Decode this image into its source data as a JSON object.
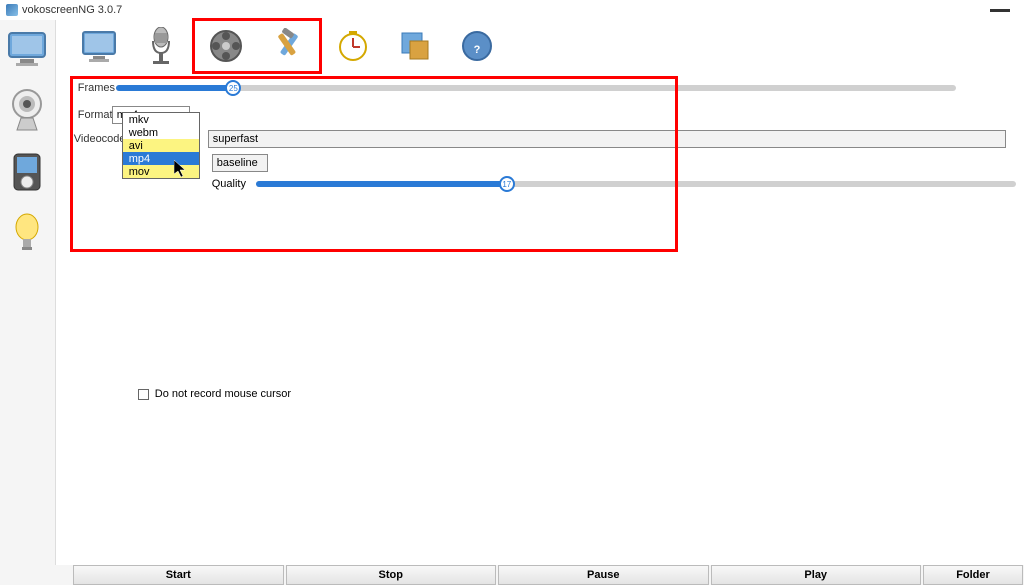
{
  "window": {
    "title": "vokoscreenNG 3.0.7"
  },
  "sidebar": {
    "items": [
      "monitor",
      "webcam",
      "player",
      "lightbulb"
    ]
  },
  "toolbar": {
    "items": [
      "screen",
      "microphone",
      "camera",
      "tools",
      "timer",
      "target",
      "help"
    ]
  },
  "settings": {
    "frames": {
      "label": "Frames",
      "value": 25,
      "max": 60
    },
    "format": {
      "label": "Format",
      "selected": "mp4",
      "options": [
        "mkv",
        "webm",
        "avi",
        "mp4",
        "mov"
      ],
      "highlighted_index": 3,
      "yellow_index": 2
    },
    "videocodec": {
      "label": "Videocodec"
    },
    "preset": {
      "value": "superfast"
    },
    "profile": {
      "value": "baseline"
    },
    "quality": {
      "label": "Quality",
      "value": 17,
      "max": 51
    }
  },
  "checkbox": {
    "label": "Do not record mouse cursor",
    "checked": false
  },
  "bottombar": {
    "start": "Start",
    "stop": "Stop",
    "pause": "Pause",
    "play": "Play",
    "folder": "Folder"
  }
}
